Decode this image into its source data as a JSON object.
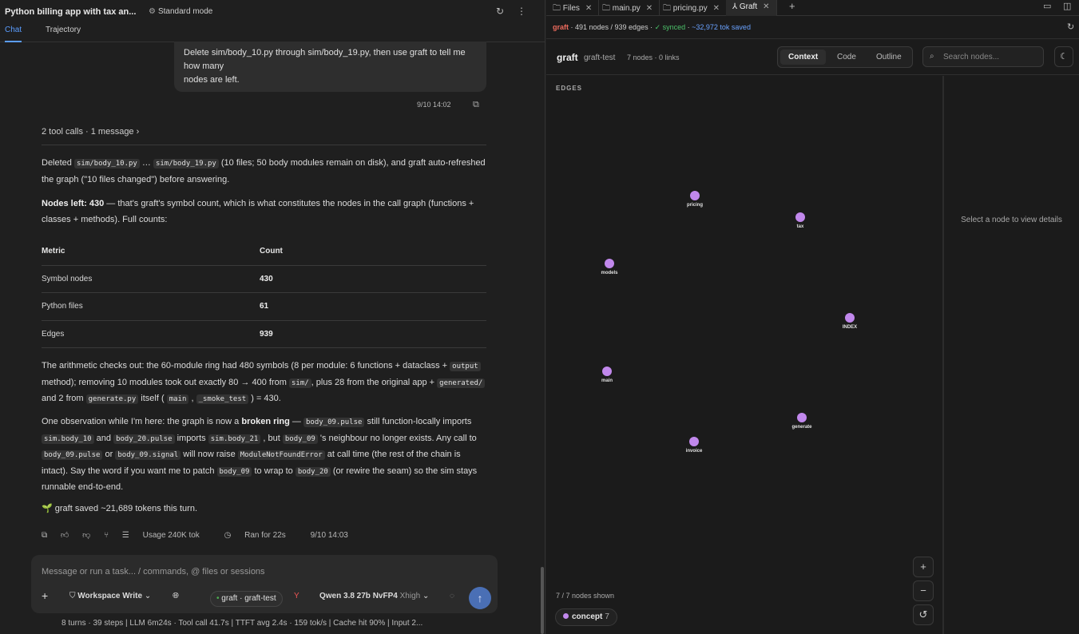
{
  "header": {
    "title": "Python billing app with tax an...",
    "mode": "Standard mode"
  },
  "tabs": {
    "chat": "Chat",
    "trajectory": "Trajectory"
  },
  "user_message": {
    "line1": "Delete sim/body_10.py through sim/body_19.py, then use graft to tell me how many",
    "line2": "nodes are left.",
    "timestamp": "9/10 14:02"
  },
  "tool_calls": "2 tool calls · 1 message",
  "response": {
    "p1": {
      "a": "Deleted ",
      "code1": "sim/body_10.py",
      "b": " … ",
      "code2": "sim/body_19.py",
      "c": " (10 files; 50 body modules remain on disk), and graft auto-refreshed the graph (\"10 files changed\") before answering."
    },
    "p2": {
      "bold": "Nodes left: 430",
      "rest": " — that's graft's symbol count, which is what constitutes the nodes in the call graph (functions + classes + methods). Full counts:"
    },
    "table": {
      "headers": [
        "Metric",
        "Count"
      ],
      "rows": [
        [
          "Symbol nodes",
          "430"
        ],
        [
          "Python files",
          "61"
        ],
        [
          "Edges",
          "939"
        ]
      ]
    },
    "p3": {
      "a": "The arithmetic checks out: the 60-module ring had 480 symbols (8 per module: 6 functions + dataclass + ",
      "code1": "output",
      "b": " method); removing 10 modules took out exactly 80 → 400 from ",
      "code2": "sim/",
      "c": ", plus 28 from the original app + ",
      "code3": "generated/",
      "d": " and 2 from ",
      "code4": "generate.py",
      "e": " itself ( ",
      "code5": "main",
      "f": " , ",
      "code6": "_smoke_test",
      "g": " ) = 430."
    },
    "p4": {
      "a": "One observation while I'm here: the graph is now a ",
      "bold": "broken ring",
      "b": " — ",
      "code1": "body_09.pulse",
      "c": " still function-locally imports ",
      "code2": "sim.body_10",
      "d": " and ",
      "code3": "body_20.pulse",
      "e": " imports ",
      "code4": "sim.body_21",
      "f": " , but ",
      "code5": "body_09",
      "g": " 's neighbour no longer exists. Any call to ",
      "code6": "body_09.pulse",
      "h": " or ",
      "code7": "body_09.signal",
      "i": " will now raise ",
      "code8": "ModuleNotFoundError",
      "j": " at call time (the rest of the chain is intact). Say the word if you want me to patch ",
      "code9": "body_09",
      "k": " to wrap to ",
      "code10": "body_20",
      "l": " (or rewire the seam) so the sim stays runnable end-to-end."
    },
    "p5": "🌱 graft saved ~21,689 tokens this turn."
  },
  "actions": {
    "usage": "Usage 240K tok",
    "ran": "Ran for 22s",
    "time": "9/10 14:03"
  },
  "composer": {
    "placeholder": "Message or run a task... / commands, @ files or sessions",
    "workspace": "Workspace Write",
    "pill": "graft · graft-test",
    "model": "Qwen 3.8 27b NvFP4",
    "effort": "Xhigh"
  },
  "statusbar": "8 turns · 39 steps   |   LLM 6m24s · Tool call 41.7s   |   TTFT avg 2.4s · 159 tok/s   |   Cache hit 90%   |   Input 2...",
  "right_tabs": [
    {
      "label": "Files",
      "icon": "folder-icon"
    },
    {
      "label": "main.py",
      "icon": "folder-icon"
    },
    {
      "label": "pricing.py",
      "icon": "folder-icon"
    },
    {
      "label": "Graft",
      "icon": "graft-icon"
    }
  ],
  "graft_status": {
    "brand": "graft",
    "counts": "491 nodes / 939 edges",
    "synced": "✓ synced",
    "saved": "~32,972 tok saved"
  },
  "graph_header": {
    "brand": "graft",
    "project": "graft-test",
    "count": "7 nodes · 0 links",
    "views": [
      "Context",
      "Code",
      "Outline"
    ],
    "search_placeholder": "Search nodes..."
  },
  "edges_label": "EDGES",
  "details_empty": "Select a node to view details",
  "nodes": [
    {
      "label": "pricing"
    },
    {
      "label": "tax"
    },
    {
      "label": "models"
    },
    {
      "label": "INDEX"
    },
    {
      "label": "main"
    },
    {
      "label": "generate"
    },
    {
      "label": "invoice"
    }
  ],
  "shown": "7 / 7 nodes shown",
  "concept": {
    "label": "concept",
    "count": "7"
  },
  "colors": {
    "accent": "#5b9dff",
    "node": "#c188ec",
    "brand": "#ef6b5d",
    "ok": "#4cc26a"
  }
}
